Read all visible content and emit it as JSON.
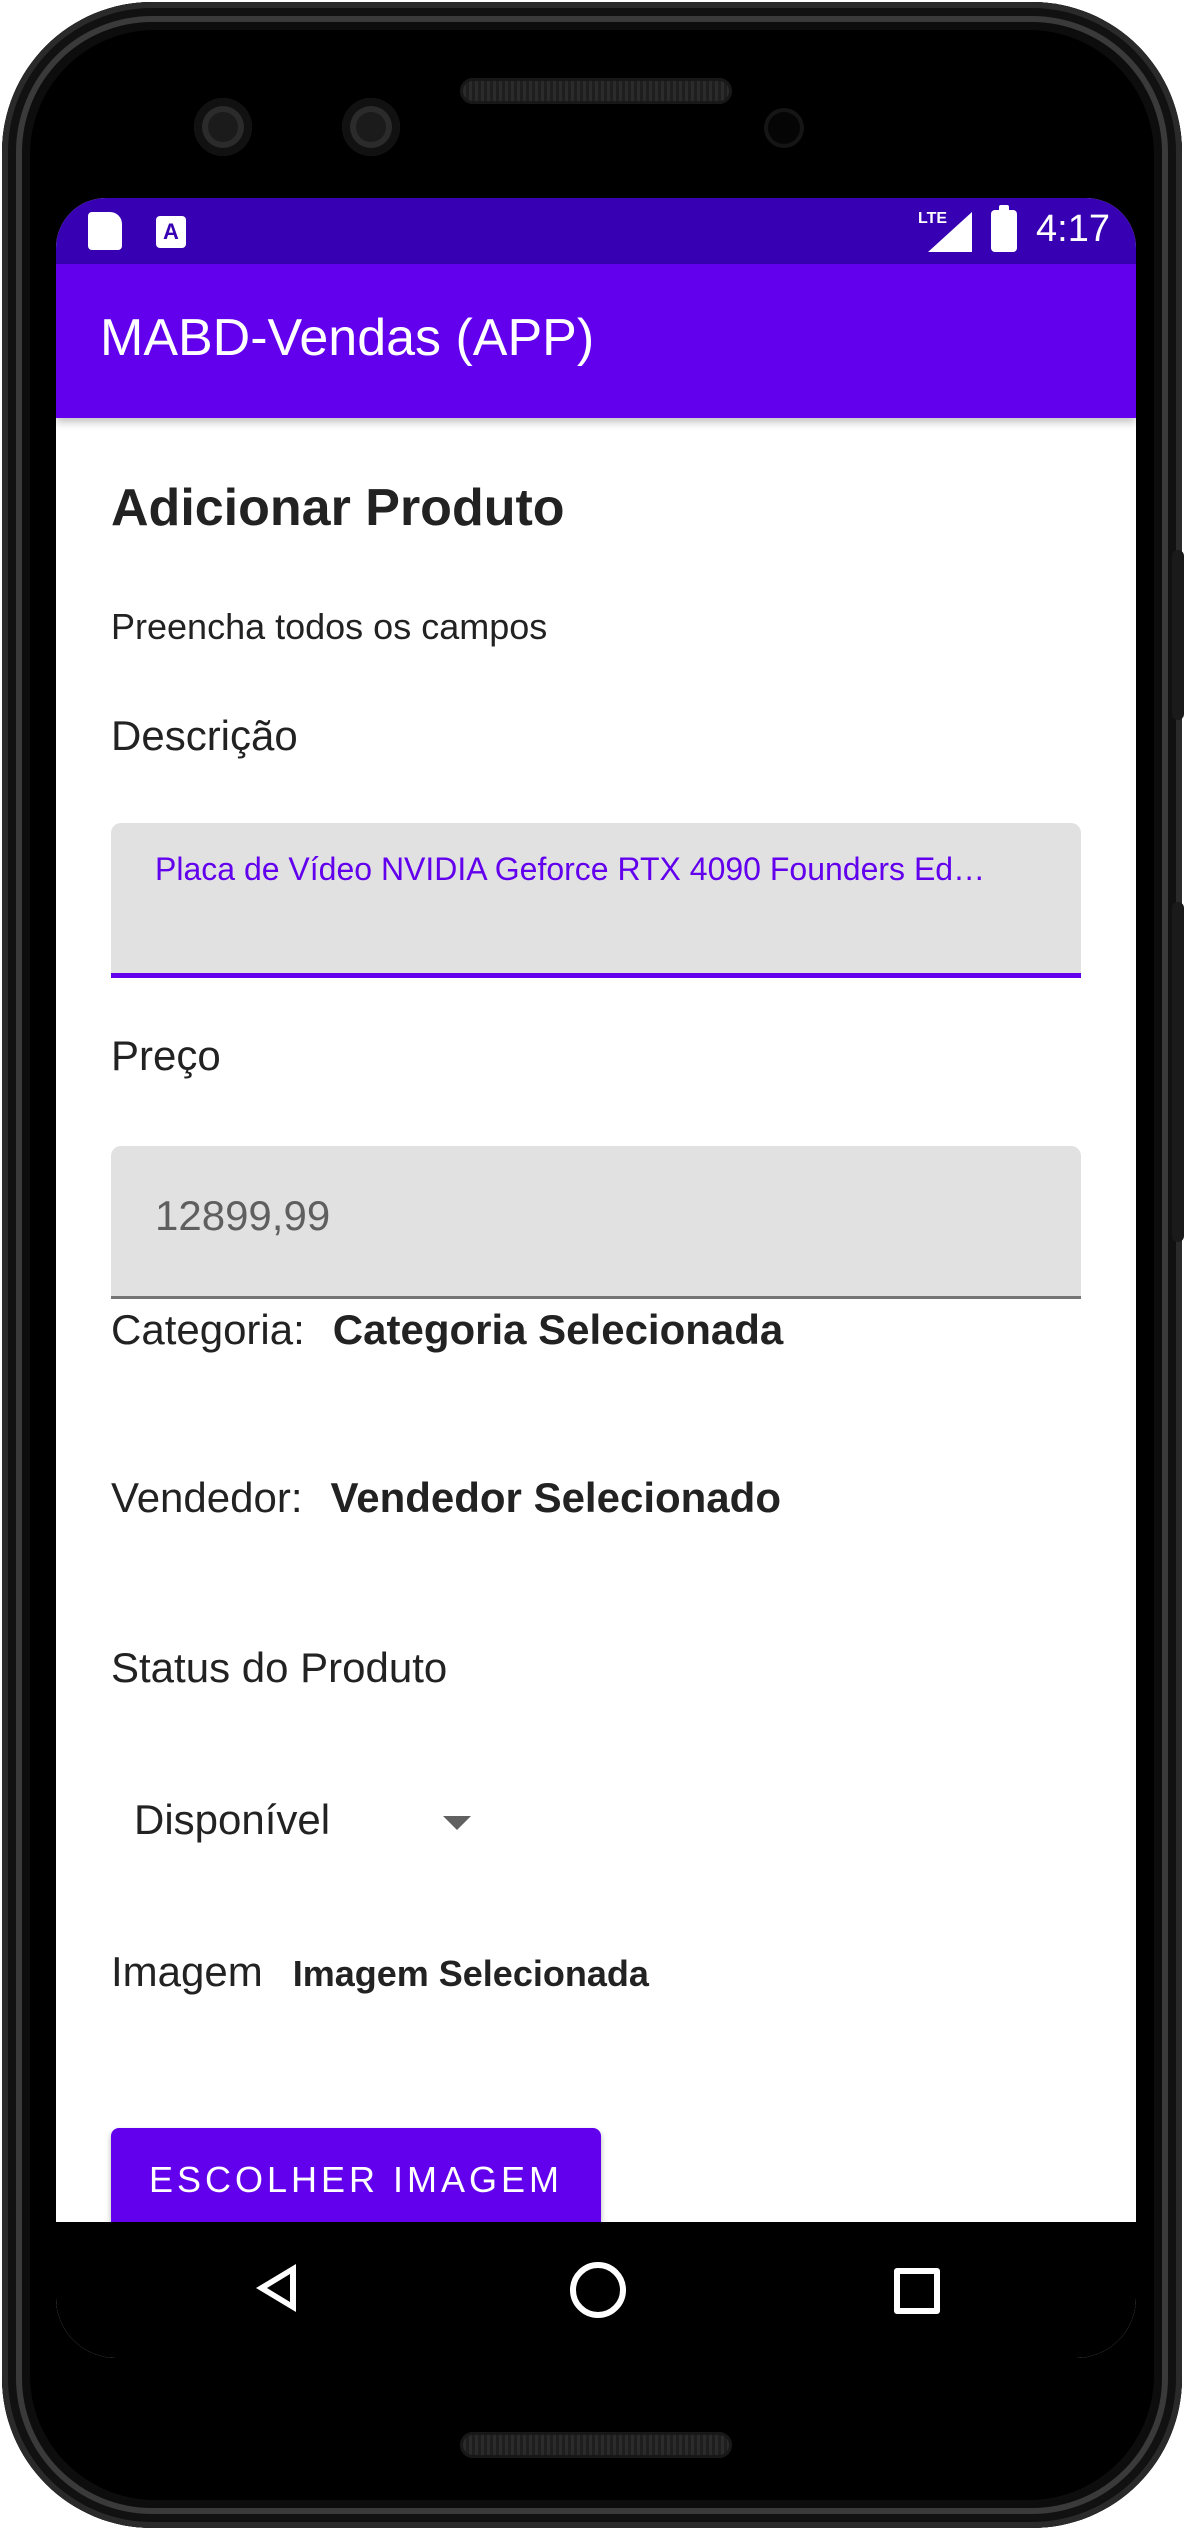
{
  "status_bar": {
    "network": "LTE",
    "time": "4:17"
  },
  "app_bar": {
    "title": "MABD-Vendas (APP)"
  },
  "form": {
    "heading": "Adicionar Produto",
    "subtitle": "Preencha todos os campos",
    "description_label": "Descrição",
    "description_value": "Placa de Vídeo NVIDIA Geforce RTX 4090 Founders Ed…",
    "price_label": "Preço",
    "price_placeholder": "12899,99",
    "category_label": "Categoria:",
    "category_value": "Categoria Selecionada",
    "seller_label": "Vendedor:",
    "seller_value": "Vendedor Selecionado",
    "status_label": "Status do Produto",
    "status_selected": "Disponível",
    "image_label": "Imagem",
    "image_value": "Imagem Selecionada",
    "choose_image_button": "ESCOLHER IMAGEM"
  },
  "colors": {
    "status_bar": "#3700b3",
    "primary": "#6200ee",
    "field_background": "#e1e1e1"
  },
  "icons": {
    "status_bar": [
      "sd-card-icon",
      "text-input-notification-icon",
      "lte-signal-icon",
      "battery-charging-icon"
    ],
    "navigation": [
      "back-icon",
      "home-icon",
      "recents-icon"
    ]
  }
}
